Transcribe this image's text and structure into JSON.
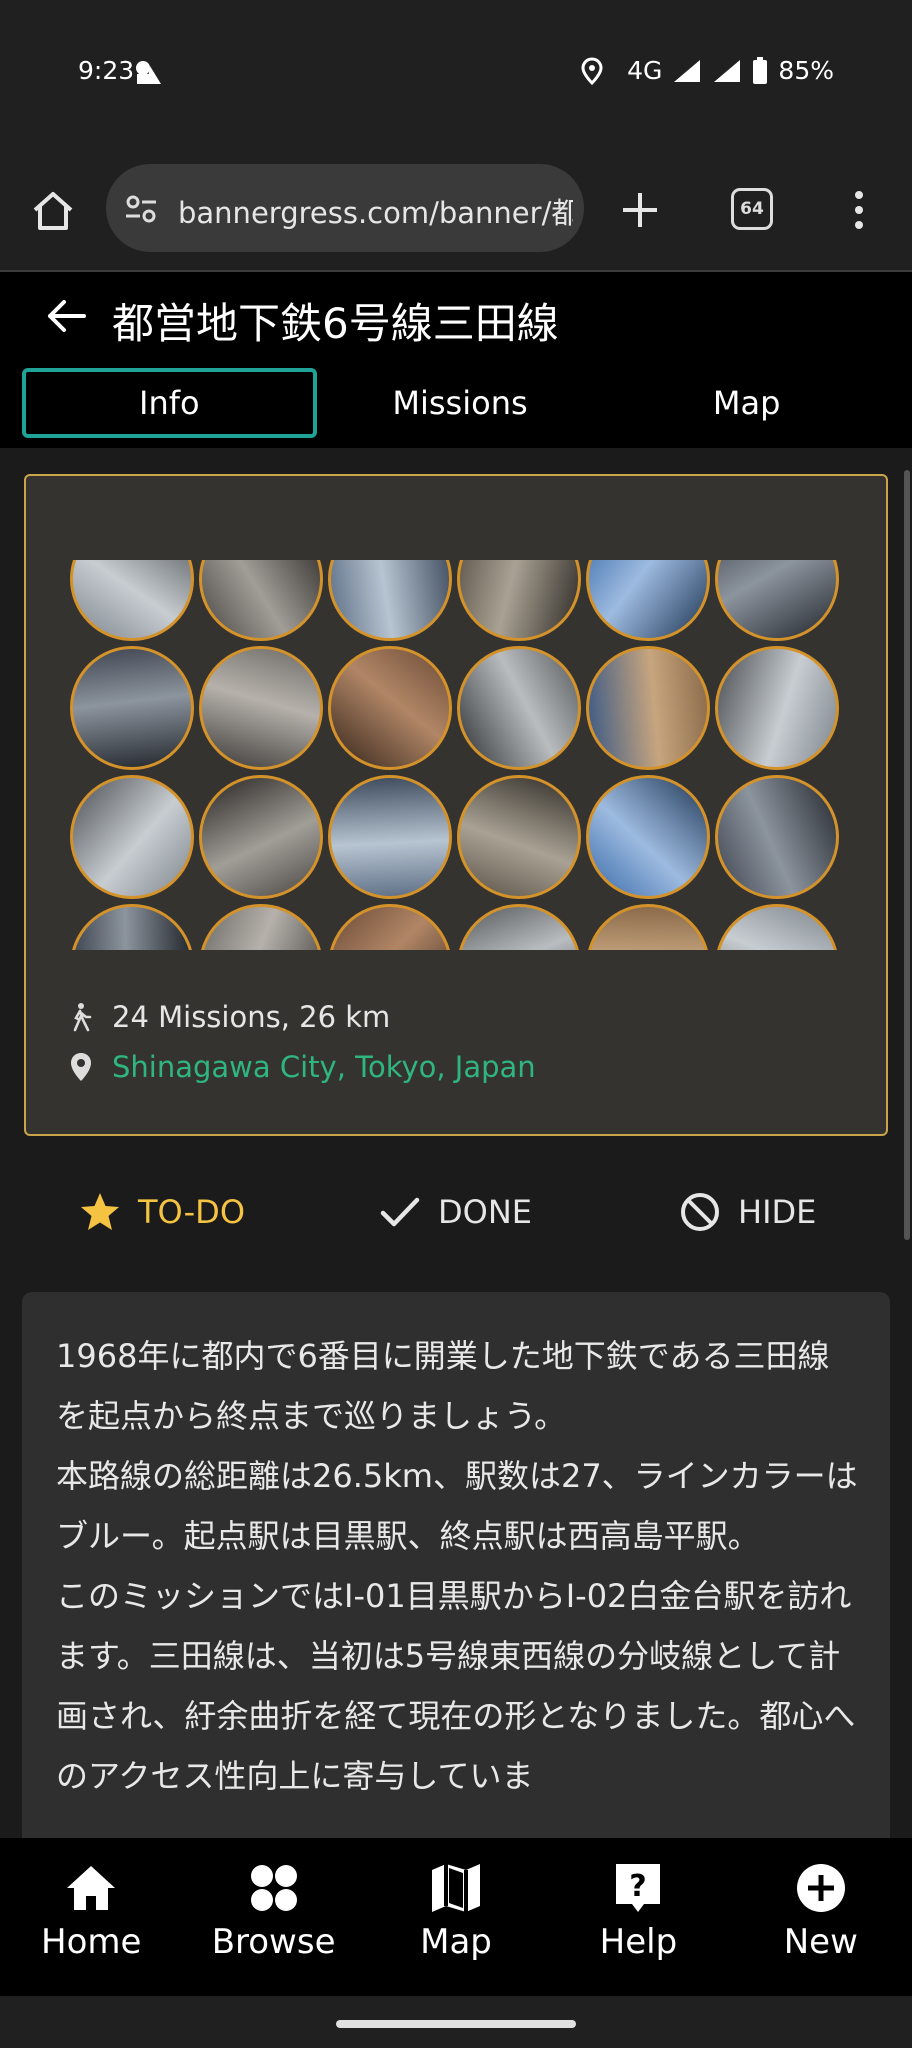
{
  "status_bar": {
    "time": "9:23",
    "network": "4G",
    "battery": "85%"
  },
  "browser": {
    "url": "bannergress.com/banner/都",
    "tab_count": "64"
  },
  "page": {
    "title": "都営地下鉄6号線三田線",
    "tabs": [
      {
        "label": "Info",
        "active": true
      },
      {
        "label": "Missions",
        "active": false
      },
      {
        "label": "Map",
        "active": false
      }
    ]
  },
  "banner": {
    "missions_text": "24 Missions, 26 km",
    "location_text": "Shinagawa City, Tokyo, Japan",
    "mission_count": 24,
    "accent_color": "#c9a44a",
    "link_color": "#2fb67e"
  },
  "actions": {
    "todo_label": "TO-DO",
    "done_label": "DONE",
    "hide_label": "HIDE",
    "todo_color": "#f5c342"
  },
  "description": {
    "text": "1968年に都内で6番目に開業した地下鉄である三田線を起点から終点まで巡りましょう。\n本路線の総距離は26.5km、駅数は27、ラインカラーはブルー。起点駅は目黒駅、終点駅は西高島平駅。\nこのミッションではI-01目黒駅からI-02白金台駅を訪れます。三田線は、当初は5号線東西線の分岐線として計画され、紆余曲折を経て現在の形となりました。都心へのアクセス性向上に寄与していま"
  },
  "bottom_nav": {
    "items": [
      {
        "label": "Home",
        "icon": "home-icon"
      },
      {
        "label": "Browse",
        "icon": "browse-icon"
      },
      {
        "label": "Map",
        "icon": "map-icon"
      },
      {
        "label": "Help",
        "icon": "help-icon"
      },
      {
        "label": "New",
        "icon": "new-icon"
      }
    ]
  }
}
